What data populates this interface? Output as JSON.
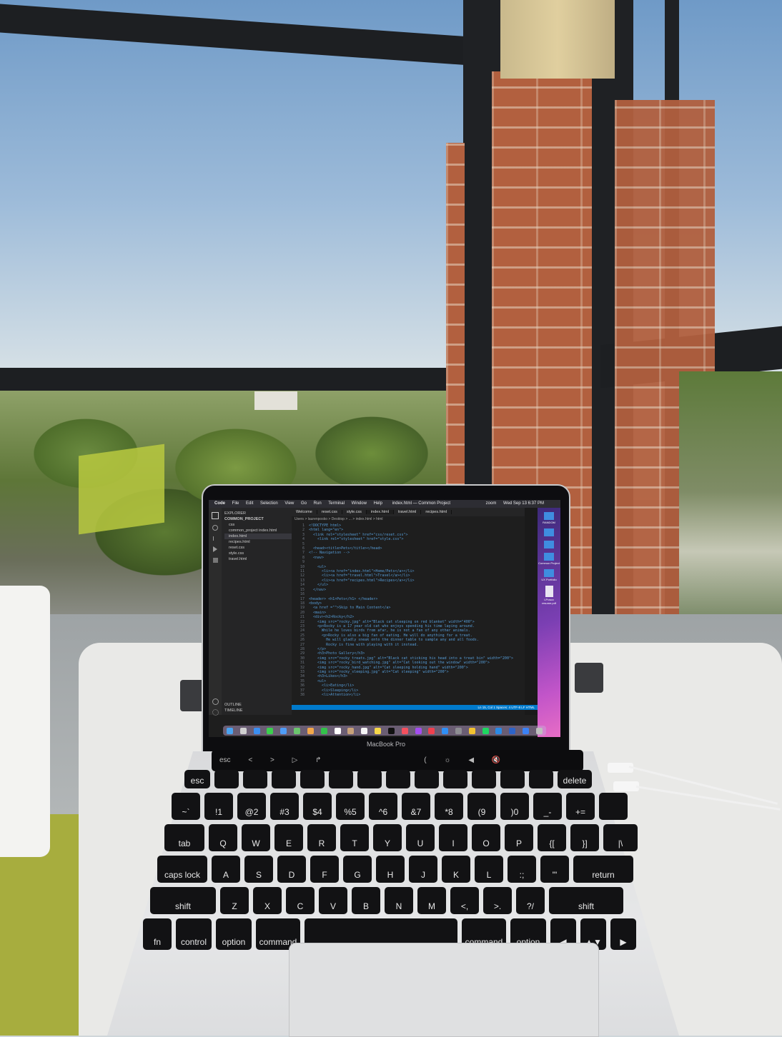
{
  "scene": {
    "description_labels": {
      "laptop_brand": "MacBook Pro"
    }
  },
  "menubar": {
    "items": [
      "Code",
      "File",
      "Edit",
      "Selection",
      "View",
      "Go",
      "Run",
      "Terminal",
      "Window",
      "Help"
    ],
    "window_title": "index.html — Common Project",
    "zoom": "zoom",
    "clock": "Wed Sep 13 6:37 PM"
  },
  "vscode": {
    "explorer_title": "EXPLORER",
    "project": "COMMON_PROJECT",
    "files": [
      "css",
      "common_project index.html",
      "index.html",
      "recipes.html",
      "reset.css",
      "style.css",
      "travel.html"
    ],
    "outline": "OUTLINE",
    "timeline": "TIMELINE",
    "tabs": [
      "Welcome",
      "reset.css",
      "style.css",
      "index.html",
      "travel.html",
      "recipes.html"
    ],
    "breadcrumb": "Users > laurenposko > Desktop > ... > index.html > html",
    "status": "Ln 15, Col 1   Spaces: 4   UTF-8   LF   HTML",
    "code_lines": [
      {
        "n": "1",
        "t": "<!DOCTYPE html>"
      },
      {
        "n": "2",
        "t": "<html lang=\"en\">"
      },
      {
        "n": "3",
        "t": "  <link rel=\"stylesheet\" href=\"css/reset.css\">"
      },
      {
        "n": "4",
        "t": "    <link rel=\"stylesheet\" href=\"style.css\">"
      },
      {
        "n": "5",
        "t": ""
      },
      {
        "n": "6",
        "t": "  <head><title>Pets</title></head>"
      },
      {
        "n": "7",
        "t": "<!-- Navigation -->"
      },
      {
        "n": "8",
        "t": "  <nav>"
      },
      {
        "n": "9",
        "t": ""
      },
      {
        "n": "10",
        "t": "    <ul>"
      },
      {
        "n": "11",
        "t": "      <li><a href=\"index.html\">Home/Pets</a></li>"
      },
      {
        "n": "12",
        "t": "      <li><a href=\"travel.html\">Travel</a></li>"
      },
      {
        "n": "13",
        "t": "      <li><a href=\"recipes.html\">Recipes</a></li>"
      },
      {
        "n": "14",
        "t": "    </ul>"
      },
      {
        "n": "15",
        "t": "  </nav>"
      },
      {
        "n": "16",
        "t": ""
      },
      {
        "n": "17",
        "t": "<header> <h1>Pets</h1> </header>"
      },
      {
        "n": "18",
        "t": "<body>"
      },
      {
        "n": "19",
        "t": "  <a href =\"\">Skip to Main Content</a>"
      },
      {
        "n": "20",
        "t": "  <main>"
      },
      {
        "n": "21",
        "t": "  <div><h2>Rocky</h2>"
      },
      {
        "n": "22",
        "t": "    <img src=\"rocky.jpg\" alt=\"Black cat sleeping on red blanket\" width=\"400\">"
      },
      {
        "n": "23",
        "t": "    <p>Rocky is a 17 year old cat who enjoys spending his time laying around."
      },
      {
        "n": "24",
        "t": "      While he loves birds from afar, he is not a fan of any other animals."
      },
      {
        "n": "25",
        "t": "      <p>Rocky is also a big fan of eating. He will do anything for a treat."
      },
      {
        "n": "26",
        "t": "        He will gladly sneak onto the dinner table to sample any and all foods."
      },
      {
        "n": "27",
        "t": "        Rocky is fine with playing with it instead."
      },
      {
        "n": "28",
        "t": "    </p>"
      },
      {
        "n": "29",
        "t": "    <h3>Photo Gallery</h3>"
      },
      {
        "n": "30",
        "t": "    <img src=\"rocky_treats.jpg\" alt=\"Black cat sticking his head into a treat bin\" width=\"200\">"
      },
      {
        "n": "31",
        "t": "    <img src=\"rocky_bird_watching.jpg\" alt=\"Cat looking out the window\" width=\"200\">"
      },
      {
        "n": "32",
        "t": "    <img src=\"rocky_hand.jpg\" alt=\"Cat sleeping holding hand\" width=\"200\">"
      },
      {
        "n": "33",
        "t": "    <img src=\"rocky_sleeping.jpg\" alt=\"Cat sleeping\" width=\"200\">"
      },
      {
        "n": "34",
        "t": "    <h3>Likes</h3>"
      },
      {
        "n": "35",
        "t": "    <ul>"
      },
      {
        "n": "36",
        "t": "      <li>Eating</li>"
      },
      {
        "n": "37",
        "t": "      <li>Sleeping</li>"
      },
      {
        "n": "38",
        "t": "      <li>Attention</li>"
      }
    ]
  },
  "desktop_icons": [
    "",
    "RANDOM",
    "",
    "",
    "Common Project",
    "UX Portfolio",
    "LPosco resume.pdf"
  ],
  "touchbar": {
    "esc": "esc",
    "items": [
      "<",
      ">",
      "▷",
      "↱",
      "(",
      "☼",
      "◀",
      "🔇"
    ]
  },
  "keyboard": {
    "row0": [
      "esc",
      "",
      "",
      "",
      "",
      "",
      "",
      "",
      "",
      "",
      "",
      "",
      "",
      "delete"
    ],
    "row1": [
      "~`",
      "!1",
      "@2",
      "#3",
      "$4",
      "%5",
      "^6",
      "&7",
      "*8",
      "(9",
      ")0",
      "_-",
      "+=",
      ""
    ],
    "row2": [
      "tab",
      "Q",
      "W",
      "E",
      "R",
      "T",
      "Y",
      "U",
      "I",
      "O",
      "P",
      "{[",
      "}]",
      "|\\"
    ],
    "row3": [
      "caps lock",
      "A",
      "S",
      "D",
      "F",
      "G",
      "H",
      "J",
      "K",
      "L",
      ":;",
      "\"'",
      "return"
    ],
    "row4": [
      "shift",
      "Z",
      "X",
      "C",
      "V",
      "B",
      "N",
      "M",
      "<,",
      ">.",
      "?/",
      "shift"
    ],
    "row5": [
      "fn",
      "control",
      "option",
      "command",
      "",
      "command",
      "option",
      "◀",
      "▲▼",
      "▶"
    ]
  },
  "colors": {
    "editor_bg": "#1e1e1e",
    "statusbar": "#007acc",
    "desktop_wallpaper": "#7b3fb3",
    "brick": "#b2603f"
  }
}
